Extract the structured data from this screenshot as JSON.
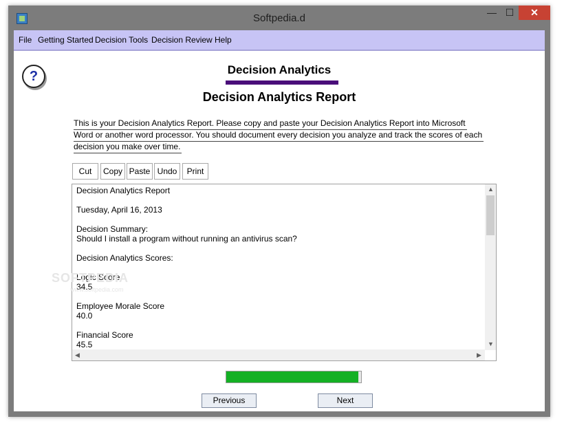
{
  "window": {
    "title": "Softpedia.d",
    "min_label": "—",
    "max_label": "☐",
    "close_label": "✕"
  },
  "menu": [
    "File",
    "Getting Started",
    "Decision Tools",
    "Decision Review",
    "Help"
  ],
  "header": {
    "app_name": "Decision Analytics",
    "report_title": "Decision Analytics Report",
    "help_symbol": "?"
  },
  "instructions": [
    "This is your Decision Analytics Report.  Please copy and paste your Decision Analytics Report into Microsoft",
    "Word or another word processor. You should document every decision you analyze and track the scores of each",
    "decision you make over time."
  ],
  "toolbar": {
    "cut": "Cut",
    "copy": "Copy",
    "paste": "Paste",
    "undo": "Undo",
    "print": "Print"
  },
  "report": {
    "lines": [
      "Decision Analytics Report",
      "",
      "Tuesday, April 16, 2013",
      "",
      "Decision Summary:",
      "Should I install a program without running an antivirus scan?",
      "",
      "Decision Analytics Scores:",
      "",
      "Logic Score",
      "34.5",
      "",
      "Employee Morale Score",
      "40.0",
      "",
      "Financial Score",
      "45.5"
    ]
  },
  "progress": {
    "value": 0.98,
    "color": "#14b024"
  },
  "nav": {
    "previous": "Previous",
    "next": "Next"
  },
  "watermark": {
    "main": "SOFTPEDIA",
    "sub": "www.softpedia.com"
  },
  "colors": {
    "menubar": "#c7c4f5",
    "heading_bar": "#4a0e7a",
    "close_button": "#c74233"
  }
}
